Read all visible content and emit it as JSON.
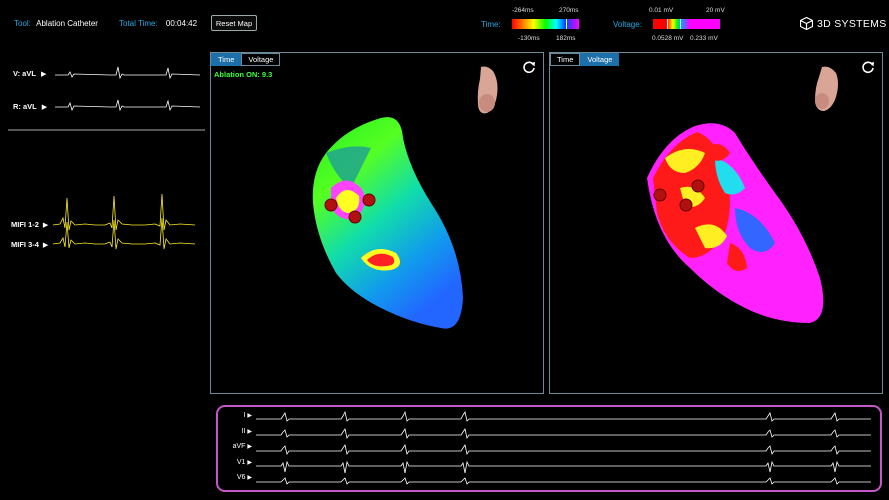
{
  "header": {
    "tool_label": "Tool:",
    "tool_value": "Ablation Catheter",
    "total_time_label": "Total Time:",
    "total_time_value": "00:04:42",
    "reset_button": "Reset Map",
    "time_scale": {
      "label": "Time:",
      "top_min": "-264ms",
      "top_max": "270ms",
      "bottom_min": "-130ms",
      "bottom_max": "182ms"
    },
    "voltage_scale": {
      "label": "Voltage:",
      "top_min": "0.01 mV",
      "top_max": "20 mV",
      "bottom_min": "0.0528 mV",
      "bottom_max": "0.233 mV"
    },
    "logo_text": "3D SYSTEMS"
  },
  "left_traces": [
    {
      "label": "V: aVL"
    },
    {
      "label": "R: aVL"
    },
    {
      "label": "MIFI 1-2"
    },
    {
      "label": "MIFI 3-4"
    }
  ],
  "viewports": [
    {
      "tabs": [
        "Time",
        "Voltage"
      ],
      "active_tab": "Time",
      "status": "Ablation ON: 9.3"
    },
    {
      "tabs": [
        "Time",
        "Voltage"
      ],
      "active_tab": "Voltage",
      "status": ""
    }
  ],
  "ecg_leads": [
    "I",
    "II",
    "aVF",
    "V1",
    "V6"
  ],
  "colors": {
    "accent_blue": "#29a8e0",
    "tab_active": "#1c6fa8",
    "ecg_border": "#c458c4",
    "ablation_text": "#3bff3b",
    "mifi_trace": "#ffee22"
  }
}
